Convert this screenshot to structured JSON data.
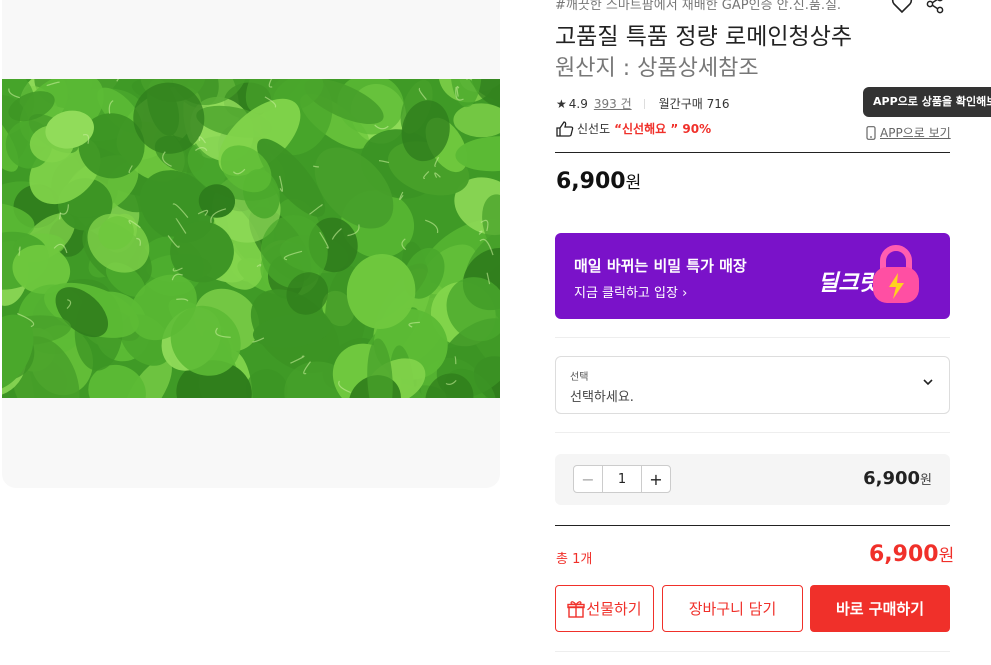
{
  "product": {
    "subtitle": "#깨끗한 스마트팜에서 재배한 GAP인증 안.신.품.질.",
    "title": "고품질 특품 정량 로메인청상추",
    "origin": "원산지 : 상품상세참조"
  },
  "rating": {
    "star": "★",
    "score": "4.9",
    "reviews": "393 건",
    "monthly_label": "월간구매 716"
  },
  "freshness": {
    "label": "신선도",
    "value": "“신선해요 ” 90%"
  },
  "app": {
    "tooltip": "APP으로 상품을 확인해보세요",
    "link": "APP으로 보기"
  },
  "price": {
    "amount": "6,900",
    "unit": "원"
  },
  "banner": {
    "headline": "매일 바뀌는 비밀 특가 매장",
    "cta": "지금 클릭하고 입장 ›",
    "logo": "딜크릿"
  },
  "option": {
    "label": "선택",
    "value": "선택하세요."
  },
  "quantity": {
    "minus": "−",
    "value": "1",
    "plus": "+",
    "line_amount": "6,900",
    "line_unit": "원"
  },
  "total": {
    "label": "총 1개",
    "amount": "6,900",
    "unit": "원"
  },
  "actions": {
    "gift": "선물하기",
    "cart": "장바구니 담기",
    "buy": "바로 구매하기"
  },
  "colors": {
    "accent": "#f0302a",
    "banner": "#7a12c9",
    "lettuce": "#3f9a26"
  },
  "icons": [
    "heart-icon",
    "share-icon",
    "thumbs-up-icon",
    "phone-icon",
    "chevron-down-icon",
    "gift-icon",
    "lock-icon"
  ]
}
